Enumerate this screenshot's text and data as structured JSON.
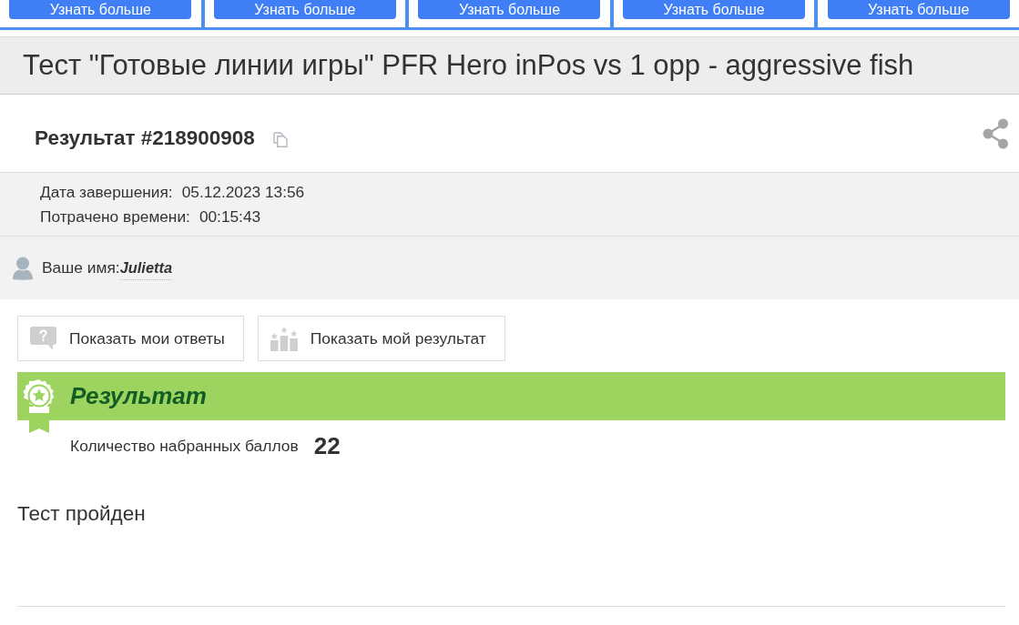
{
  "promo_buttons": [
    "Узнать больше",
    "Узнать больше",
    "Узнать больше",
    "Узнать больше",
    "Узнать больше"
  ],
  "test_title": "Тест \"Готовые линии игры\" PFR Hero inPos vs 1 opp - aggressive fish",
  "result": {
    "title": "Результат #218900908"
  },
  "details": [
    {
      "label": "Дата завершения:",
      "value": "05.12.2023 13:56"
    },
    {
      "label": "Потрачено времени:",
      "value": "00:15:43"
    }
  ],
  "user": {
    "label": "Ваше имя:",
    "name": "Julietta"
  },
  "actions": [
    {
      "kind": "question",
      "label": "Показать мои ответы"
    },
    {
      "kind": "podium",
      "label": "Показать мой результат"
    }
  ],
  "score_panel": {
    "heading": "Результат",
    "label": "Количество набранных баллов",
    "value": "22"
  },
  "verdict": "Тест пройден"
}
